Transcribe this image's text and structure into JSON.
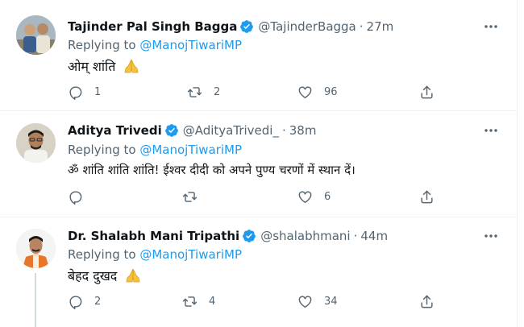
{
  "tweets": [
    {
      "name": "Tajinder Pal Singh Bagga",
      "handle": "@TajinderBagga",
      "sep": "·",
      "time": "27m",
      "replying_prefix": "Replying to",
      "mention": "@ManojTiwariMP",
      "text": "ओम् शांति",
      "emoji": "folded-hands-icon",
      "replies": "1",
      "retweets": "2",
      "likes": "96"
    },
    {
      "name": "Aditya Trivedi",
      "handle": "@AdityaTrivedi_",
      "sep": "·",
      "time": "38m",
      "replying_prefix": "Replying to",
      "mention": "@ManojTiwariMP",
      "text": "ॐ शांति शांति शांति! ईश्वर दीदी को अपने पुण्य चरणों में स्थान दें।",
      "replies": "",
      "retweets": "",
      "likes": "6"
    },
    {
      "name": "Dr. Shalabh Mani Tripathi",
      "handle": "@shalabhmani",
      "sep": "·",
      "time": "44m",
      "replying_prefix": "Replying to",
      "mention": "@ManojTiwariMP",
      "text": "बेहद दुखद",
      "emoji": "folded-hands-icon",
      "replies": "2",
      "retweets": "4",
      "likes": "34"
    }
  ],
  "colors": {
    "accent": "#1d9bf0",
    "secondary_text": "#536471",
    "divider": "#eff3f4"
  }
}
